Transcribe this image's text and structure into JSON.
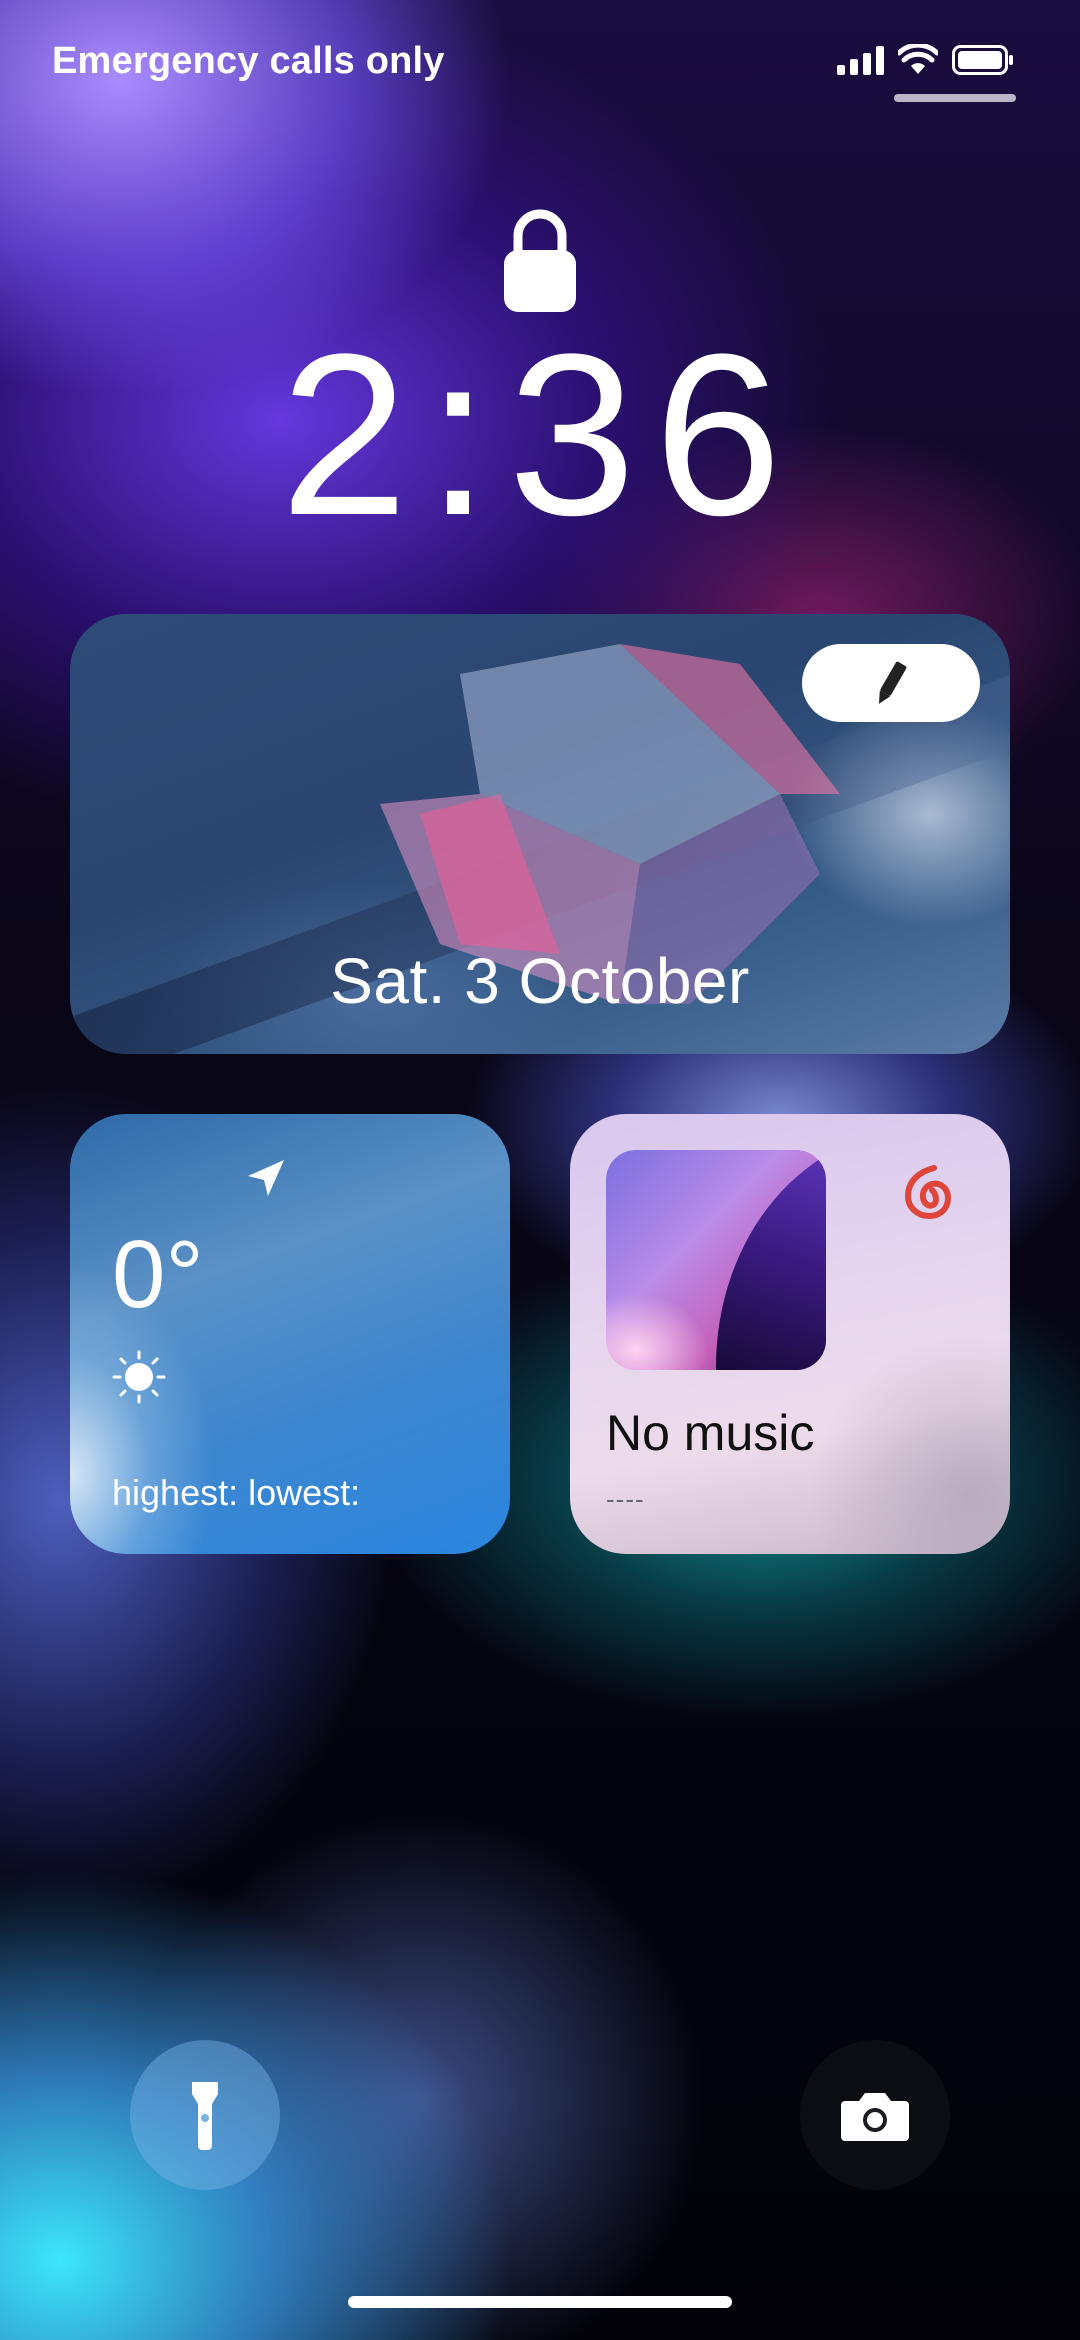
{
  "status_bar": {
    "carrier_text": "Emergency calls only",
    "icons": [
      "signal-icon",
      "wifi-icon",
      "battery-icon"
    ]
  },
  "lock_screen": {
    "lock_icon": "lock-icon",
    "time": "2:36"
  },
  "photo_widget": {
    "date": "Sat. 3 October",
    "edit_icon": "pencil-icon"
  },
  "weather_widget": {
    "temperature": "0°",
    "condition_icon": "sun-icon",
    "high_low": "highest: lowest:",
    "location_icon": "location-arrow-icon"
  },
  "music_widget": {
    "title": "No music",
    "subtitle": "----",
    "app_icon": "netease-music-icon",
    "accent": "#e0453a"
  },
  "quick_actions": {
    "left": "flashlight-icon",
    "right": "camera-icon"
  }
}
